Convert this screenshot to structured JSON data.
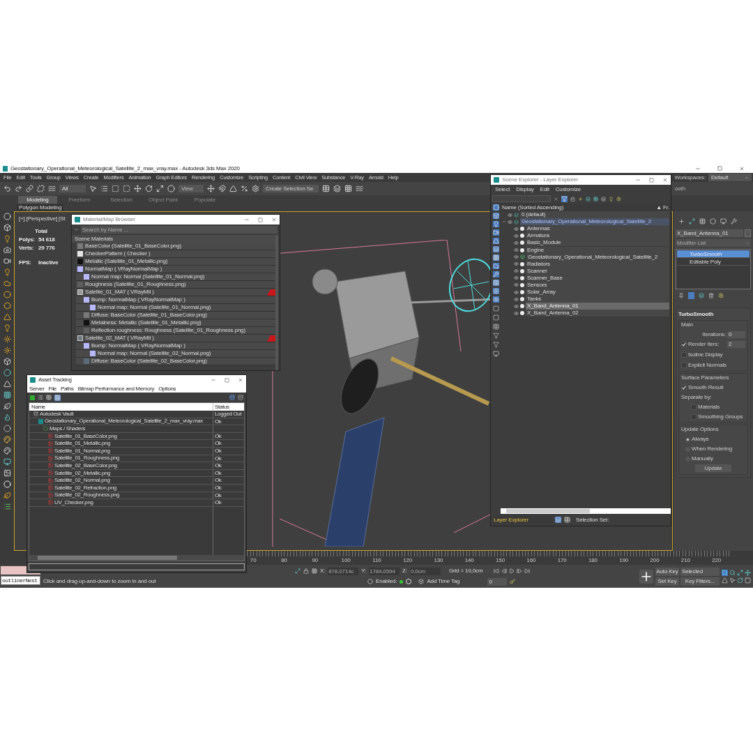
{
  "title_bar": {
    "title": "Geostationary_Operational_Meteorological_Satellite_2_max_vray.max - Autodesk 3ds Max 2020"
  },
  "menu_bar": [
    "File",
    "Edit",
    "Tools",
    "Group",
    "Views",
    "Create",
    "Modifiers",
    "Animation",
    "Graph Editors",
    "Rendering",
    "Customize",
    "Scripting",
    "Content",
    "Civil View",
    "Substance",
    "V-Ray",
    "Arnold",
    "Help"
  ],
  "workspaces": {
    "label": "Workspaces:",
    "value": "Default"
  },
  "toolbar": {
    "filter": "All",
    "reference": "View",
    "selection_set": "Create Selection Se",
    "cut_label": "ooth"
  },
  "ribbon": {
    "tabs": [
      {
        "label": "Modeling",
        "selected": true
      },
      {
        "label": "Freeform",
        "selected": false
      },
      {
        "label": "Selection",
        "selected": false
      },
      {
        "label": "Object Paint",
        "selected": false
      },
      {
        "label": "Populate",
        "selected": false
      }
    ],
    "panel": "Polygon Modeling"
  },
  "viewport": {
    "label": "[+] [Perspective] [St",
    "stats_heading": "Total",
    "stats": [
      {
        "label": "Polys:",
        "value": "54 618"
      },
      {
        "label": "Verts:",
        "value": "29 776"
      },
      {
        "label": "FPS:",
        "value": "Inactive"
      }
    ]
  },
  "material_browser": {
    "title": "Material/Map Browser",
    "search_placeholder": "Search by Name ...",
    "group": "Scene Materials",
    "items": [
      {
        "label": "BaseColor (Satellite_01_BaseColor.png)",
        "kind": "map",
        "color": "#7a7a7a"
      },
      {
        "label": "CheckerPattern  ( Checker )",
        "kind": "map",
        "color": "#e6e6e6"
      },
      {
        "label": "Metallic (Satellite_01_Metallic.png)",
        "kind": "map",
        "color": "#111111"
      },
      {
        "label": "NormalMap  ( VRayNormalMap )",
        "kind": "map",
        "color": "#b8b8ff",
        "children": [
          {
            "label": "Normal map: Normal (Satellite_01_Normal.png)",
            "kind": "map",
            "color": "#b8b8ff"
          }
        ]
      },
      {
        "label": "Roughness (Satellite_01_Roughness.png)",
        "kind": "map",
        "color": "#5e5e5e"
      },
      {
        "label": "Satelite_01_MAT  ( VRayMtl )",
        "kind": "material",
        "color": "#9a9a9a",
        "children": [
          {
            "label": "Bump: NormalMap  ( VRayNormalMap )",
            "kind": "map",
            "color": "#b8b8ff",
            "children": [
              {
                "label": "Normal map: Normal (Satellite_01_Normal.png)",
                "kind": "map",
                "color": "#b8b8ff"
              }
            ]
          },
          {
            "label": "Diffuse: BaseColor (Satellite_01_BaseColor.png)",
            "kind": "map",
            "color": "#7a7a7a"
          },
          {
            "label": "Metalness: Metallic (Satellite_01_Metallic.png)",
            "kind": "map",
            "color": "#111111"
          },
          {
            "label": "Reflection roughness: Roughness (Satellite_01_Roughness.png)",
            "kind": "map",
            "color": "#5e5e5e"
          }
        ]
      },
      {
        "label": "Satelite_02_MAT  ( VRayMtl )",
        "kind": "material",
        "color": "#6f7a85",
        "children": [
          {
            "label": "Bump: NormalMap  ( VRayNormalMap )",
            "kind": "map",
            "color": "#b8b8ff",
            "children": [
              {
                "label": "Normal map: Normal (Satellite_02_Normal.png)",
                "kind": "map",
                "color": "#b8b8ff"
              }
            ]
          },
          {
            "label": "Diffuse: BaseColor (Satellite_02_BaseColor.png)",
            "kind": "map",
            "color": "#5b6b7a"
          }
        ]
      }
    ]
  },
  "asset_tracking": {
    "title": "Asset Tracking",
    "menu": [
      "Server",
      "File",
      "Paths",
      "Bitmap Performance and Memory",
      "Options"
    ],
    "columns": [
      "Name",
      "Status"
    ],
    "rows": [
      {
        "name": "Autodesk Vault",
        "kind": "vault",
        "status": "Logged Out",
        "children": [
          {
            "name": "Geostationary_Operational_Meteorological_Satellite_2_max_vray.max",
            "kind": "scene",
            "status": "Ok",
            "children": [
              {
                "name": "Maps / Shaders",
                "kind": "folder",
                "children": [
                  {
                    "name": "Satellite_01_BaseColor.png",
                    "kind": "image",
                    "status": "Ok"
                  },
                  {
                    "name": "Satellite_01_Metallic.png",
                    "kind": "image",
                    "status": "Ok"
                  },
                  {
                    "name": "Satellite_01_Normal.png",
                    "kind": "image",
                    "status": "Ok"
                  },
                  {
                    "name": "Satellite_01_Roughness.png",
                    "kind": "image",
                    "status": "Ok"
                  },
                  {
                    "name": "Satellite_02_BaseColor.png",
                    "kind": "image",
                    "status": "Ok"
                  },
                  {
                    "name": "Satellite_02_Metallic.png",
                    "kind": "image",
                    "status": "Ok"
                  },
                  {
                    "name": "Satellite_02_Normal.png",
                    "kind": "image",
                    "status": "Ok"
                  },
                  {
                    "name": "Satellite_02_Refraction.png",
                    "kind": "image",
                    "status": "Ok"
                  },
                  {
                    "name": "Satellite_02_Roughness.png",
                    "kind": "image",
                    "status": "Ok"
                  },
                  {
                    "name": "UV_Checker.png",
                    "kind": "image",
                    "status": "Ok"
                  }
                ]
              }
            ]
          }
        ]
      }
    ]
  },
  "scene_explorer": {
    "title": "Scene Explorer - Layer Explorer",
    "menu": [
      "Select",
      "Display",
      "Edit",
      "Customize"
    ],
    "header": "Name (Sorted Ascending)",
    "header_2": "▲ Fr.",
    "items": [
      {
        "name": "0 (default)",
        "kind": "layer",
        "selected": false
      },
      {
        "name": "Geostationary_Operational_Meteorological_Satellite_2",
        "kind": "layer",
        "selected": true,
        "children": [
          {
            "name": "Antennas",
            "kind": "object",
            "selected": false
          },
          {
            "name": "Armatura",
            "kind": "object",
            "selected": false
          },
          {
            "name": "Basic_Module",
            "kind": "object",
            "selected": false
          },
          {
            "name": "Engine",
            "kind": "object",
            "selected": false
          },
          {
            "name": "Geostationary_Operational_Meteorological_Satellite_2",
            "kind": "group",
            "selected": false
          },
          {
            "name": "Radiators",
            "kind": "object",
            "selected": false
          },
          {
            "name": "Scanner",
            "kind": "object",
            "selected": false
          },
          {
            "name": "Scanner_Base",
            "kind": "object",
            "selected": false
          },
          {
            "name": "Sensors",
            "kind": "object",
            "selected": false
          },
          {
            "name": "Solar_Array",
            "kind": "object",
            "selected": false
          },
          {
            "name": "Tanks",
            "kind": "object",
            "selected": false
          },
          {
            "name": "X_Band_Antenna_01",
            "kind": "object",
            "selected": true
          },
          {
            "name": "X_Band_Antenna_02",
            "kind": "object",
            "selected": false
          }
        ]
      }
    ],
    "footer_label": "Layer Explorer",
    "footer_set": "Selection Set:"
  },
  "command_panel": {
    "object_name": "X_Band_Antenna_01",
    "modifier_list": "Modifier List",
    "stack": [
      {
        "label": "TurboSmooth",
        "selected": true
      },
      {
        "label": "Editable Poly",
        "selected": false
      }
    ],
    "rollout": "TurboSmooth",
    "main": {
      "title": "Main",
      "iterations_label": "Iterations:",
      "iterations": "0",
      "render_iters": {
        "label": "Render Iters:",
        "checked": true,
        "value": "2"
      },
      "options": [
        {
          "label": "Isoline Display",
          "checked": false
        },
        {
          "label": "Explicit Normals",
          "checked": false
        }
      ]
    },
    "surface": {
      "title": "Surface Parameters",
      "smooth_result": {
        "label": "Smooth Result",
        "checked": true
      },
      "separate_by": "Separate by:",
      "options": [
        {
          "label": "Materials",
          "checked": false
        },
        {
          "label": "Smoothing Groups",
          "checked": false
        }
      ]
    },
    "update": {
      "title": "Update Options",
      "radios": [
        {
          "label": "Always",
          "selected": true
        },
        {
          "label": "When Rendering",
          "selected": false
        },
        {
          "label": "Manually",
          "selected": false
        }
      ],
      "button": "Update"
    }
  },
  "timeline": {
    "ticks": [
      "70",
      "80",
      "90",
      "100",
      "110",
      "120",
      "130",
      "140",
      "150",
      "160",
      "170",
      "180",
      "190",
      "200",
      "210",
      "220"
    ]
  },
  "status_bar": {
    "script_field": "outlinerNest",
    "prompt": "Click and drag up-and-down to zoom in and out",
    "coords": [
      {
        "label": "X:",
        "value": "878,0714c"
      },
      {
        "label": "Y:",
        "value": "1784,0594"
      },
      {
        "label": "Z:",
        "value": "0,0cm"
      }
    ],
    "grid": "Grid = 10,0cm",
    "enabled": "Enabled:",
    "time_tag": "Add Time Tag",
    "frame": "0",
    "auto_key": "Auto Key",
    "set_key": "Set Key",
    "key_mode": "Selected",
    "key_filters": "Key Filters..."
  }
}
